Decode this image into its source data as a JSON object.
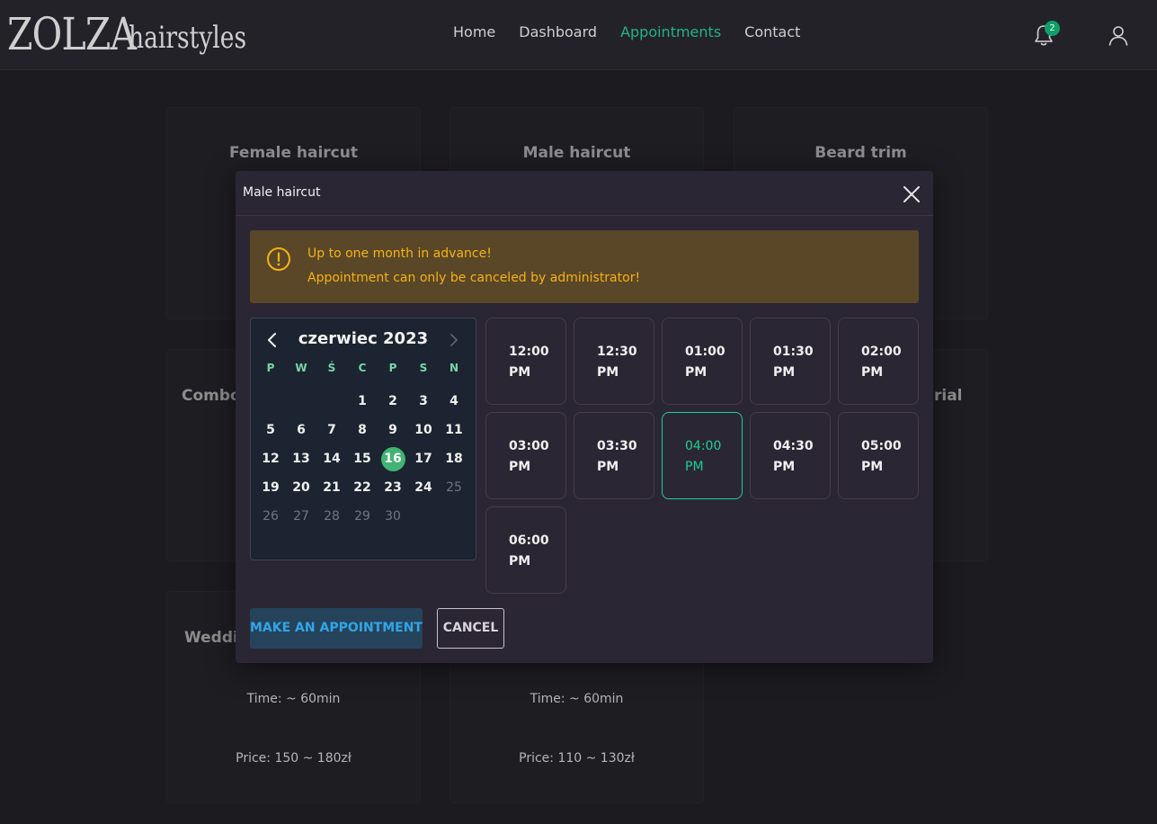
{
  "brand": {
    "logo_mark": "ZOLZA",
    "logo_word": "hairstyles"
  },
  "nav": {
    "items": [
      {
        "label": "Home",
        "active": false
      },
      {
        "label": "Dashboard",
        "active": false
      },
      {
        "label": "Appointments",
        "active": true
      },
      {
        "label": "Contact",
        "active": false
      }
    ],
    "notification_count": "2",
    "icons": {
      "notifications": "bell-icon",
      "account": "user-icon"
    }
  },
  "cards": [
    {
      "title": "Female haircut"
    },
    {
      "title": "Male haircut"
    },
    {
      "title": "Beard trim"
    },
    {
      "title": "Combo"
    },
    {
      "title": "rial"
    },
    {
      "title": "Weddi",
      "time": "Time: ~ 60min",
      "price": "Price: 150 ~ 180zł"
    },
    {
      "time": "Time: ~ 60min",
      "price": "Price: 110 ~ 130zł"
    }
  ],
  "modal": {
    "title": "Male haircut",
    "close_icon": "close-icon",
    "alert": {
      "icon": "alert-circle-icon",
      "line1": "Up to one month in advance!",
      "line2": "Appointment can only be canceled by administrator!"
    },
    "calendar": {
      "month_label": "czerwiec 2023",
      "weekdays": [
        "P",
        "W",
        "Ś",
        "C",
        "P",
        "S",
        "N"
      ],
      "leading_blank_days": 3,
      "days": [
        1,
        2,
        3,
        4,
        5,
        6,
        7,
        8,
        9,
        10,
        11,
        12,
        13,
        14,
        15,
        16,
        17,
        18,
        19,
        20,
        21,
        22,
        23,
        24,
        25,
        26,
        27,
        28,
        29,
        30
      ],
      "selected_day": 16,
      "disabled_days": [
        25,
        26,
        27,
        28,
        29,
        30
      ]
    },
    "time_slots": [
      {
        "line1": "12:00",
        "line2": "PM"
      },
      {
        "line1": "12:30",
        "line2": "PM"
      },
      {
        "line1": "01:00",
        "line2": "PM"
      },
      {
        "line1": "01:30",
        "line2": "PM"
      },
      {
        "line1": "02:00",
        "line2": "PM"
      },
      {
        "line1": "03:00",
        "line2": "PM"
      },
      {
        "line1": "03:30",
        "line2": "PM"
      },
      {
        "line1": "04:00",
        "line2": "PM"
      },
      {
        "line1": "04:30",
        "line2": "PM"
      },
      {
        "line1": "05:00",
        "line2": "PM"
      },
      {
        "line1": "06:00",
        "line2": "PM"
      }
    ],
    "selected_slot": "04:00 PM",
    "buttons": {
      "make": "MAKE AN APPOINTMENT",
      "cancel": "CANCEL"
    }
  },
  "colors": {
    "accent_green": "#21b487",
    "selected_day": "#41b374",
    "alert_text": "#f5b215",
    "primary_button_text": "#31a5e8"
  }
}
